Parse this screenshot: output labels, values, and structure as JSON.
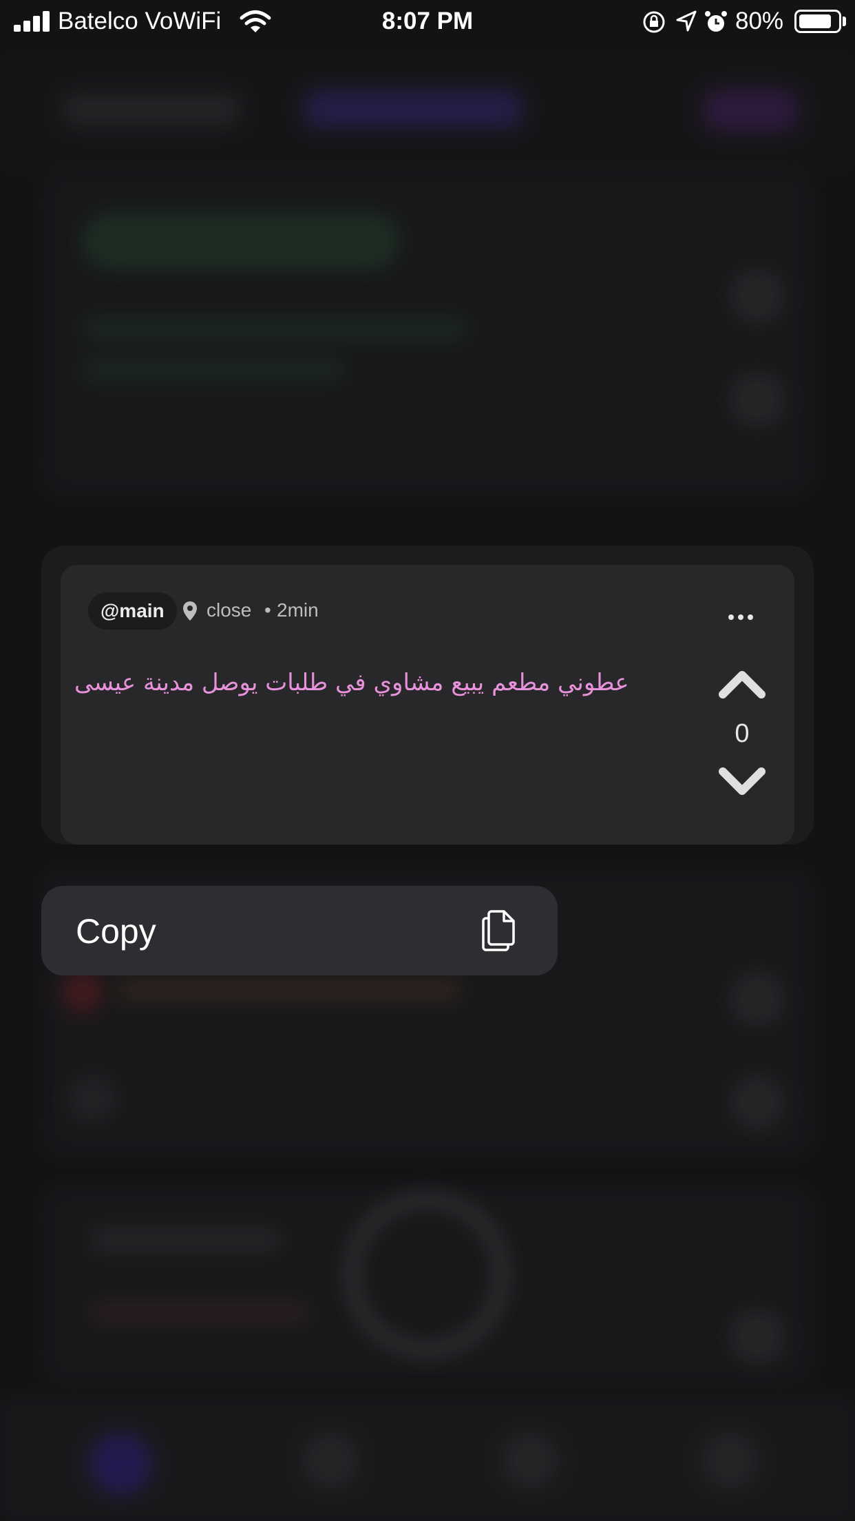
{
  "status_bar": {
    "carrier": "Batelco VoWiFi",
    "time": "8:07 PM",
    "battery": "80%",
    "icons": [
      "signal-icon",
      "wifi-icon",
      "orientation-lock-icon",
      "location-arrow-icon",
      "alarm-icon",
      "battery-icon"
    ]
  },
  "post": {
    "handle": "@main",
    "location": "close",
    "separator": "•",
    "time": "2min",
    "message": "عطوني مطعم يبيع مشاوي في طلبات يوصل مدينة عيسى",
    "votes": "0"
  },
  "context_menu": {
    "items": [
      {
        "label": "Copy",
        "icon": "copy-icon"
      }
    ]
  },
  "colors": {
    "message_text": "#e892dc",
    "card_bg": "#28282b",
    "menu_bg": "#2e2e32"
  }
}
